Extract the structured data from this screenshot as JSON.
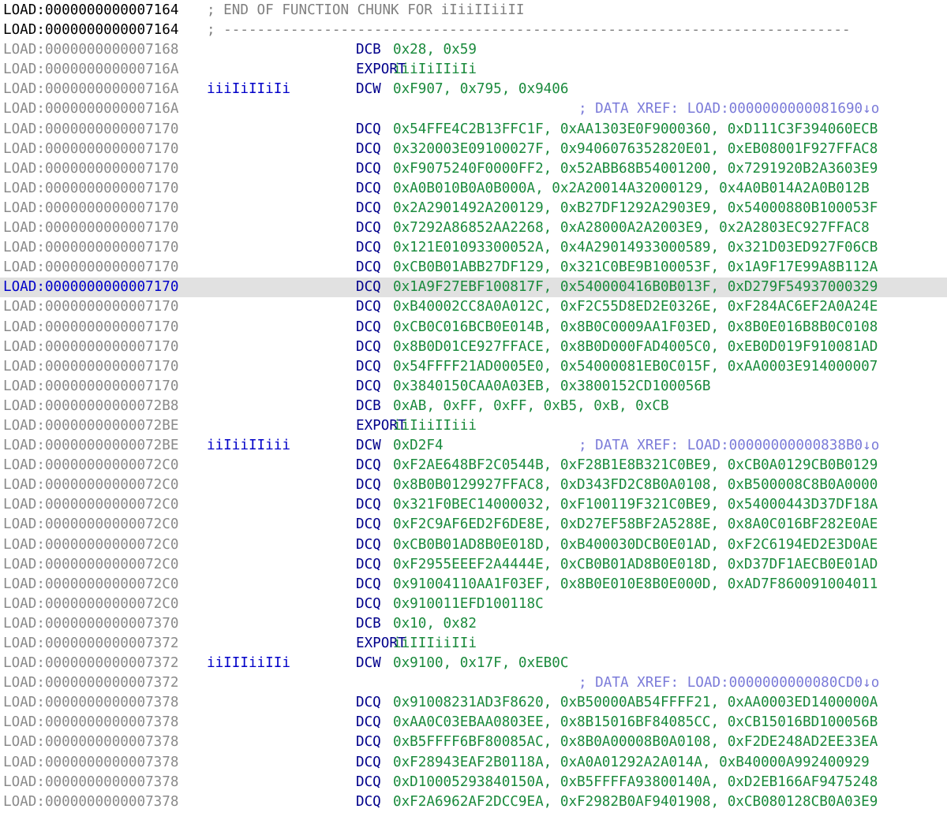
{
  "listing": [
    {
      "addr": "LOAD:0000000000007164",
      "header": true,
      "label": "",
      "mnemonic": "",
      "operands": "",
      "comment": "; END OF FUNCTION CHUNK FOR iIiiIIiiII"
    },
    {
      "addr": "LOAD:0000000000007164",
      "header": true,
      "label": "",
      "mnemonic": "",
      "operands": "",
      "comment": "; ---------------------------------------------------------------------------"
    },
    {
      "addr": "LOAD:0000000000007168",
      "label": "",
      "mnemonic": "DCB",
      "operands": "0x28, 0x59",
      "comment": ""
    },
    {
      "addr": "LOAD:000000000000716A",
      "label": "",
      "mnemonic": "EXPORT",
      "operands": "iiiIiIIiIi",
      "comment": ""
    },
    {
      "addr": "LOAD:000000000000716A",
      "label": "iiiIiIIiIi",
      "mnemonic": "DCW",
      "operands": "0xF907, 0x795, 0x9406",
      "comment": ""
    },
    {
      "addr": "LOAD:000000000000716A",
      "label": "",
      "mnemonic": "",
      "operands": "",
      "comment": "; DATA XREF: LOAD:0000000000081690↓o"
    },
    {
      "addr": "LOAD:0000000000007170",
      "label": "",
      "mnemonic": "DCQ",
      "operands": "0x54FFE4C2B13FFC1F, 0xAA1303E0F9000360, 0xD111C3F394060ECB",
      "comment": ""
    },
    {
      "addr": "LOAD:0000000000007170",
      "label": "",
      "mnemonic": "DCQ",
      "operands": "0x320003E09100027F, 0x9406076352820E01, 0xEB08001F927FFAC8",
      "comment": ""
    },
    {
      "addr": "LOAD:0000000000007170",
      "label": "",
      "mnemonic": "DCQ",
      "operands": "0xF9075240F0000FF2, 0x52ABB68B54001200, 0x7291920B2A3603E9",
      "comment": ""
    },
    {
      "addr": "LOAD:0000000000007170",
      "label": "",
      "mnemonic": "DCQ",
      "operands": "0xA0B010B0A0B000A, 0x2A20014A32000129, 0x4A0B014A2A0B012B",
      "comment": ""
    },
    {
      "addr": "LOAD:0000000000007170",
      "label": "",
      "mnemonic": "DCQ",
      "operands": "0x2A2901492A200129, 0xB27DF1292A2903E9, 0x54000880B100053F",
      "comment": ""
    },
    {
      "addr": "LOAD:0000000000007170",
      "label": "",
      "mnemonic": "DCQ",
      "operands": "0x7292A86852AA2268, 0xA28000A2A2003E9, 0x2A2803EC927FFAC8",
      "comment": ""
    },
    {
      "addr": "LOAD:0000000000007170",
      "label": "",
      "mnemonic": "DCQ",
      "operands": "0x121E01093300052A, 0x4A29014933000589, 0x321D03ED927F06CB",
      "comment": ""
    },
    {
      "addr": "LOAD:0000000000007170",
      "label": "",
      "mnemonic": "DCQ",
      "operands": "0xCB0B01ABB27DF129, 0x321C0BE9B100053F, 0x1A9F17E99A8B112A",
      "comment": ""
    },
    {
      "addr": "LOAD:0000000000007170",
      "highlight": true,
      "label": "",
      "mnemonic": "DCQ",
      "operands": "0x1A9F27EBF100817F, 0x540000416B0B013F, 0xD279F54937000329",
      "comment": ""
    },
    {
      "addr": "LOAD:0000000000007170",
      "label": "",
      "mnemonic": "DCQ",
      "operands": "0xB40002CC8A0A012C, 0xF2C55D8ED2E0326E, 0xF284AC6EF2A0A24E",
      "comment": ""
    },
    {
      "addr": "LOAD:0000000000007170",
      "label": "",
      "mnemonic": "DCQ",
      "operands": "0xCB0C016BCB0E014B, 0x8B0C0009AA1F03ED, 0x8B0E016B8B0C0108",
      "comment": ""
    },
    {
      "addr": "LOAD:0000000000007170",
      "label": "",
      "mnemonic": "DCQ",
      "operands": "0x8B0D01CE927FFACE, 0x8B0D000FAD4005C0, 0xEB0D019F910081AD",
      "comment": ""
    },
    {
      "addr": "LOAD:0000000000007170",
      "label": "",
      "mnemonic": "DCQ",
      "operands": "0x54FFFF21AD0005E0, 0x54000081EB0C015F, 0xAA0003E914000007",
      "comment": ""
    },
    {
      "addr": "LOAD:0000000000007170",
      "label": "",
      "mnemonic": "DCQ",
      "operands": "0x3840150CAA0A03EB, 0x3800152CD100056B",
      "comment": ""
    },
    {
      "addr": "LOAD:00000000000072B8",
      "label": "",
      "mnemonic": "DCB",
      "operands": "0xAB, 0xFF, 0xFF, 0xB5, 0xB, 0xCB",
      "comment": ""
    },
    {
      "addr": "LOAD:00000000000072BE",
      "label": "",
      "mnemonic": "EXPORT",
      "operands": "iiIiiIIiii",
      "comment": ""
    },
    {
      "addr": "LOAD:00000000000072BE",
      "label": "iiIiiIIiii",
      "mnemonic": "DCW",
      "operands": "0xD2F4",
      "comment": "; DATA XREF: LOAD:00000000000838B0↓o"
    },
    {
      "addr": "LOAD:00000000000072C0",
      "label": "",
      "mnemonic": "DCQ",
      "operands": "0xF2AE648BF2C0544B, 0xF28B1E8B321C0BE9, 0xCB0A0129CB0B0129",
      "comment": ""
    },
    {
      "addr": "LOAD:00000000000072C0",
      "label": "",
      "mnemonic": "DCQ",
      "operands": "0x8B0B0129927FFAC8, 0xD343FD2C8B0A0108, 0xB500008C8B0A0000",
      "comment": ""
    },
    {
      "addr": "LOAD:00000000000072C0",
      "label": "",
      "mnemonic": "DCQ",
      "operands": "0x321F0BEC14000032, 0xF100119F321C0BE9, 0x54000443D37DF18A",
      "comment": ""
    },
    {
      "addr": "LOAD:00000000000072C0",
      "label": "",
      "mnemonic": "DCQ",
      "operands": "0xF2C9AF6ED2F6DE8E, 0xD27EF58BF2A5288E, 0x8A0C016BF282E0AE",
      "comment": ""
    },
    {
      "addr": "LOAD:00000000000072C0",
      "label": "",
      "mnemonic": "DCQ",
      "operands": "0xCB0B01AD8B0E018D, 0xB400030DCB0E01AD, 0xF2C6194ED2E3D0AE",
      "comment": ""
    },
    {
      "addr": "LOAD:00000000000072C0",
      "label": "",
      "mnemonic": "DCQ",
      "operands": "0xF2955EEEF2A4444E, 0xCB0B01AD8B0E018D, 0xD37DF1AECB0E01AD",
      "comment": ""
    },
    {
      "addr": "LOAD:00000000000072C0",
      "label": "",
      "mnemonic": "DCQ",
      "operands": "0x91004110AA1F03EF, 0x8B0E010E8B0E000D, 0xAD7F860091004011",
      "comment": ""
    },
    {
      "addr": "LOAD:00000000000072C0",
      "label": "",
      "mnemonic": "DCQ",
      "operands": "0x910011EFD100118C",
      "comment": ""
    },
    {
      "addr": "LOAD:0000000000007370",
      "label": "",
      "mnemonic": "DCB",
      "operands": "0x10, 0x82",
      "comment": ""
    },
    {
      "addr": "LOAD:0000000000007372",
      "label": "",
      "mnemonic": "EXPORT",
      "operands": "iiIIIiiIIi",
      "comment": ""
    },
    {
      "addr": "LOAD:0000000000007372",
      "label": "iiIIIiiIIi",
      "mnemonic": "DCW",
      "operands": "0x9100, 0x17F, 0xEB0C",
      "comment": ""
    },
    {
      "addr": "LOAD:0000000000007372",
      "label": "",
      "mnemonic": "",
      "operands": "",
      "comment": "; DATA XREF: LOAD:0000000000080CD0↓o"
    },
    {
      "addr": "LOAD:0000000000007378",
      "label": "",
      "mnemonic": "DCQ",
      "operands": "0x91008231AD3F8620, 0xB50000AB54FFFF21, 0xAA0003ED1400000A",
      "comment": ""
    },
    {
      "addr": "LOAD:0000000000007378",
      "label": "",
      "mnemonic": "DCQ",
      "operands": "0xAA0C03EBAA0803EE, 0x8B15016BF84085CC, 0xCB15016BD100056B",
      "comment": ""
    },
    {
      "addr": "LOAD:0000000000007378",
      "label": "",
      "mnemonic": "DCQ",
      "operands": "0xB5FFFF6BF80085AC, 0x8B0A00008B0A0108, 0xF2DE248AD2EE33EA",
      "comment": ""
    },
    {
      "addr": "LOAD:0000000000007378",
      "label": "",
      "mnemonic": "DCQ",
      "operands": "0xF28943EAF2B0118A, 0xA0A01292A2A014A, 0xB40000A992400929",
      "comment": ""
    },
    {
      "addr": "LOAD:0000000000007378",
      "label": "",
      "mnemonic": "DCQ",
      "operands": "0xD10005293840150A, 0xB5FFFFA93800140A, 0xD2EB166AF9475248",
      "comment": ""
    },
    {
      "addr": "LOAD:0000000000007378",
      "label": "",
      "mnemonic": "DCQ",
      "operands": "0xF2A6962AF2DCC9EA, 0xF2982B0AF9401908, 0xCB080128CB0A03E9",
      "comment": ""
    }
  ],
  "colors": {
    "address": "#8a8a8a",
    "address_header": "#000000",
    "address_highlight": "#0000c8",
    "label": "#0000c8",
    "mnemonic": "#00008b",
    "operands": "#1a8a3c",
    "xref_comment": "#7b7bd9",
    "header_comment": "#7f7f7f",
    "highlight_background": "#e1e1e1"
  }
}
